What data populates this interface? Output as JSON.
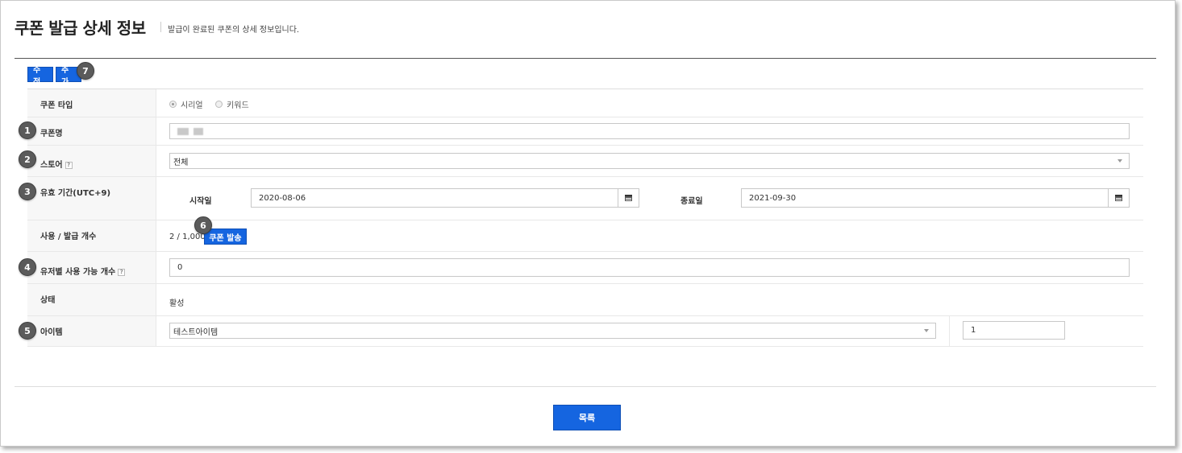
{
  "header": {
    "title": "쿠폰 발급 상세 정보",
    "description": "발급이 완료된 쿠폰의 상세 정보입니다."
  },
  "toolbar": {
    "edit_label": "수정",
    "add_label": "추가"
  },
  "badges": [
    "1",
    "2",
    "3",
    "4",
    "5",
    "6",
    "7"
  ],
  "form": {
    "coupon_type": {
      "label": "쿠폰 타입",
      "options": [
        "시리얼",
        "키워드"
      ],
      "selected": "시리얼"
    },
    "coupon_name": {
      "label": "쿠폰명"
    },
    "store": {
      "label": "스토어",
      "help": "?",
      "selected": "전체"
    },
    "validity": {
      "label": "유효 기간(UTC+9)",
      "start_label": "시작일",
      "start_value": "2020-08-06",
      "end_label": "종료일",
      "end_value": "2021-09-30"
    },
    "usage": {
      "label": "사용 / 발급 개수",
      "value": "2 / 1,000",
      "send_button": "쿠폰 발송"
    },
    "per_user": {
      "label": "유저별 사용 가능 개수",
      "help": "?",
      "value": "0"
    },
    "status": {
      "label": "상태",
      "value": "활성"
    },
    "item": {
      "label": "아이템",
      "selected": "테스트아이템",
      "quantity": "1"
    }
  },
  "footer": {
    "list_button": "목록"
  },
  "colors": {
    "primary": "#1565e0",
    "badge": "#5b5b5b",
    "label_bg": "#f7f7f7"
  }
}
